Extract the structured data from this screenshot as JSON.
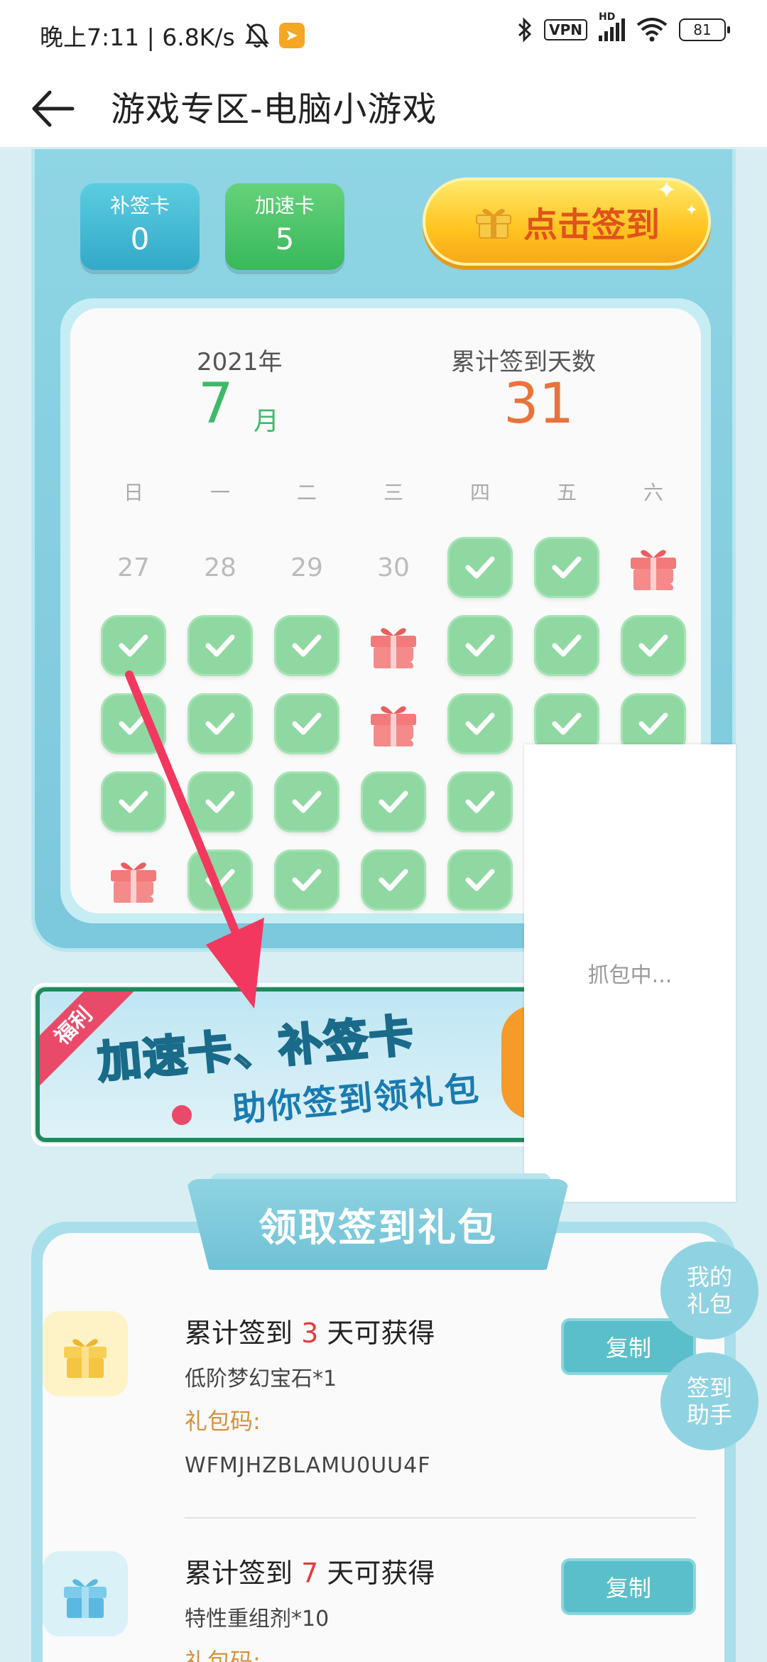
{
  "status_bar": {
    "time_speed": "晚上7:11 | 6.8K/s",
    "vpn": "VPN",
    "hd": "HD",
    "battery": "81"
  },
  "header": {
    "title": "游戏专区-电脑小游戏"
  },
  "cards": {
    "makeup_label": "补签卡",
    "makeup_count": "0",
    "speed_label": "加速卡",
    "speed_count": "5"
  },
  "signin_button": "点击签到",
  "calendar": {
    "year": "2021年",
    "month": "7",
    "month_unit": "月",
    "total_label": "累计签到天数",
    "total_days": "31",
    "weekdays": [
      "日",
      "一",
      "二",
      "三",
      "四",
      "五",
      "六"
    ],
    "cells": [
      "27",
      "28",
      "29",
      "30",
      "check",
      "check",
      "gift",
      "check",
      "check",
      "check",
      "gift",
      "check",
      "check",
      "check",
      "check",
      "check",
      "check",
      "gift",
      "check",
      "check",
      "check",
      "check",
      "check",
      "check",
      "check",
      "check",
      "",
      ""
    ],
    "last_row": [
      "gift",
      "check",
      "check",
      "check",
      "check",
      "",
      ""
    ]
  },
  "banner": {
    "ribbon": "福利",
    "line1": "加速卡、补签卡",
    "line2": "助你签到领礼包"
  },
  "capture_overlay": "抓包中...",
  "gift_section": {
    "title": "领取签到礼包",
    "items": [
      {
        "req_prefix": "累计签到 ",
        "days": "3",
        "req_suffix": " 天可获得",
        "item": "低阶梦幻宝石*1",
        "code_label": "礼包码:",
        "code": "WFMJHZBLAMU0UU4F",
        "button": "复制"
      },
      {
        "req_prefix": "累计签到 ",
        "days": "7",
        "req_suffix": " 天可获得",
        "item": "特性重组剂*10",
        "code_label": "礼包码:",
        "button": "复制"
      }
    ]
  },
  "float_buttons": {
    "my_gift": "我的礼包",
    "assistant": "签到助手"
  },
  "colors": {
    "accent_green": "#3fb96a",
    "accent_orange": "#e8743b",
    "teal_button": "#5bbfca",
    "annotation_arrow": "#f2385f"
  }
}
